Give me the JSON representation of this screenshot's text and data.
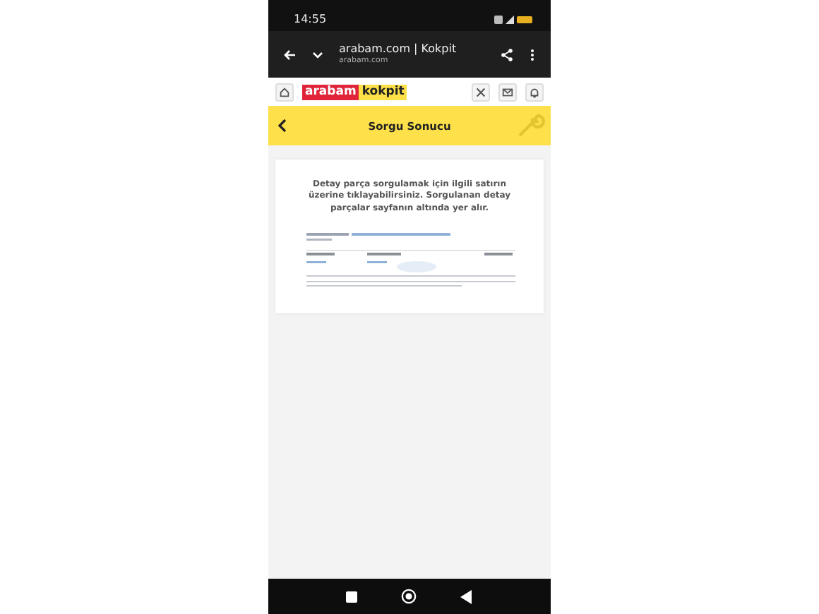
{
  "status_bar": {
    "time": "14:55"
  },
  "browser": {
    "title": "arabam.com | Kokpit",
    "url": "arabam.com"
  },
  "site_header": {
    "logo": [
      "arabam",
      "kokpit"
    ]
  },
  "page_bar": {
    "title": "Sorgu Sonucu"
  },
  "card": {
    "message": "Detay parça sorgulamak için ilgili satırın üzerine tıklayabilirsiniz. Sorgulanan detay parçalar sayfanın altında yer alır."
  }
}
